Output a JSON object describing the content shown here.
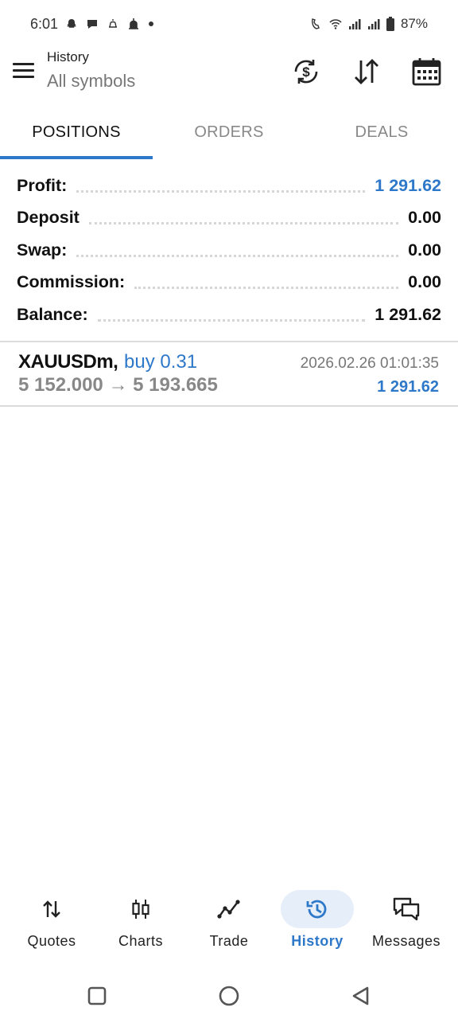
{
  "status_bar": {
    "time": "6:01",
    "battery": "87%"
  },
  "app_bar": {
    "subtitle": "History",
    "title": "All symbols"
  },
  "tabs": [
    {
      "label": "POSITIONS",
      "active": true
    },
    {
      "label": "ORDERS",
      "active": false
    },
    {
      "label": "DEALS",
      "active": false
    }
  ],
  "summary": {
    "profit": {
      "label": "Profit:",
      "value": "1 291.62"
    },
    "deposit": {
      "label": "Deposit",
      "value": "0.00"
    },
    "swap": {
      "label": "Swap:",
      "value": "0.00"
    },
    "commission": {
      "label": "Commission:",
      "value": "0.00"
    },
    "balance": {
      "label": "Balance:",
      "value": "1 291.62"
    }
  },
  "deals": [
    {
      "symbol": "XAUUSDm,",
      "type": "buy 0.31",
      "time": "2026.02.26 01:01:35",
      "prices": "5 152.000 → 5 193.665",
      "profit": "1 291.62"
    }
  ],
  "bottom_nav": [
    {
      "label": "Quotes",
      "icon": "quotes-arrows-icon",
      "active": false
    },
    {
      "label": "Charts",
      "icon": "candlestick-icon",
      "active": false
    },
    {
      "label": "Trade",
      "icon": "trade-line-icon",
      "active": false
    },
    {
      "label": "History",
      "icon": "history-clock-icon",
      "active": true
    },
    {
      "label": "Messages",
      "icon": "chat-bubbles-icon",
      "active": false
    }
  ],
  "colors": {
    "accent": "#2e78c9",
    "active_tab_bg": "#e6eef9",
    "muted_text": "#888888"
  }
}
